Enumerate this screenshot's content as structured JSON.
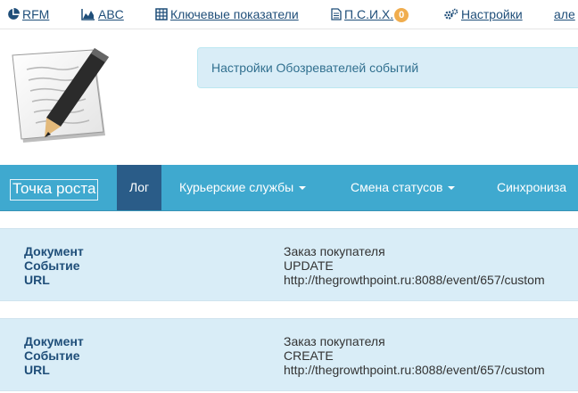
{
  "topnav": {
    "rfm": {
      "label": "RFM",
      "icon": "pie-chart-icon"
    },
    "abc": {
      "label": "ABC",
      "icon": "area-chart-icon"
    },
    "kpi": {
      "label": "Ключевые показатели",
      "icon": "table-icon"
    },
    "psih": {
      "label": "П.С.И.Х.",
      "icon": "document-icon",
      "badge": "0"
    },
    "settings": {
      "label": "Настройки",
      "icon": "gears-icon"
    },
    "user": {
      "label": "але"
    }
  },
  "alert": {
    "text": "Настройки Обозревателей событий"
  },
  "navbar": {
    "brand": "Точка роста",
    "items": [
      {
        "label": "Лог",
        "active": true
      },
      {
        "label": "Курьерские службы",
        "dropdown": true
      },
      {
        "label": "Смена статусов",
        "dropdown": true
      },
      {
        "label": "Синхрониза"
      }
    ]
  },
  "events": [
    {
      "labels": {
        "document": "Документ",
        "event": "Событие",
        "url": "URL"
      },
      "document": "Заказ покупателя",
      "event": "UPDATE",
      "url": "http://thegrowthpoint.ru:8088/event/657/custom"
    },
    {
      "labels": {
        "document": "Документ",
        "event": "Событие",
        "url": "URL"
      },
      "document": "Заказ покупателя",
      "event": "CREATE",
      "url": "http://thegrowthpoint.ru:8088/event/657/custom"
    }
  ],
  "colors": {
    "navbar": "#3fa9cf",
    "navbar_active": "#2a5c88",
    "alert_bg": "#d9edf7",
    "link": "#1f4e79",
    "badge": "#f0ad4e"
  }
}
